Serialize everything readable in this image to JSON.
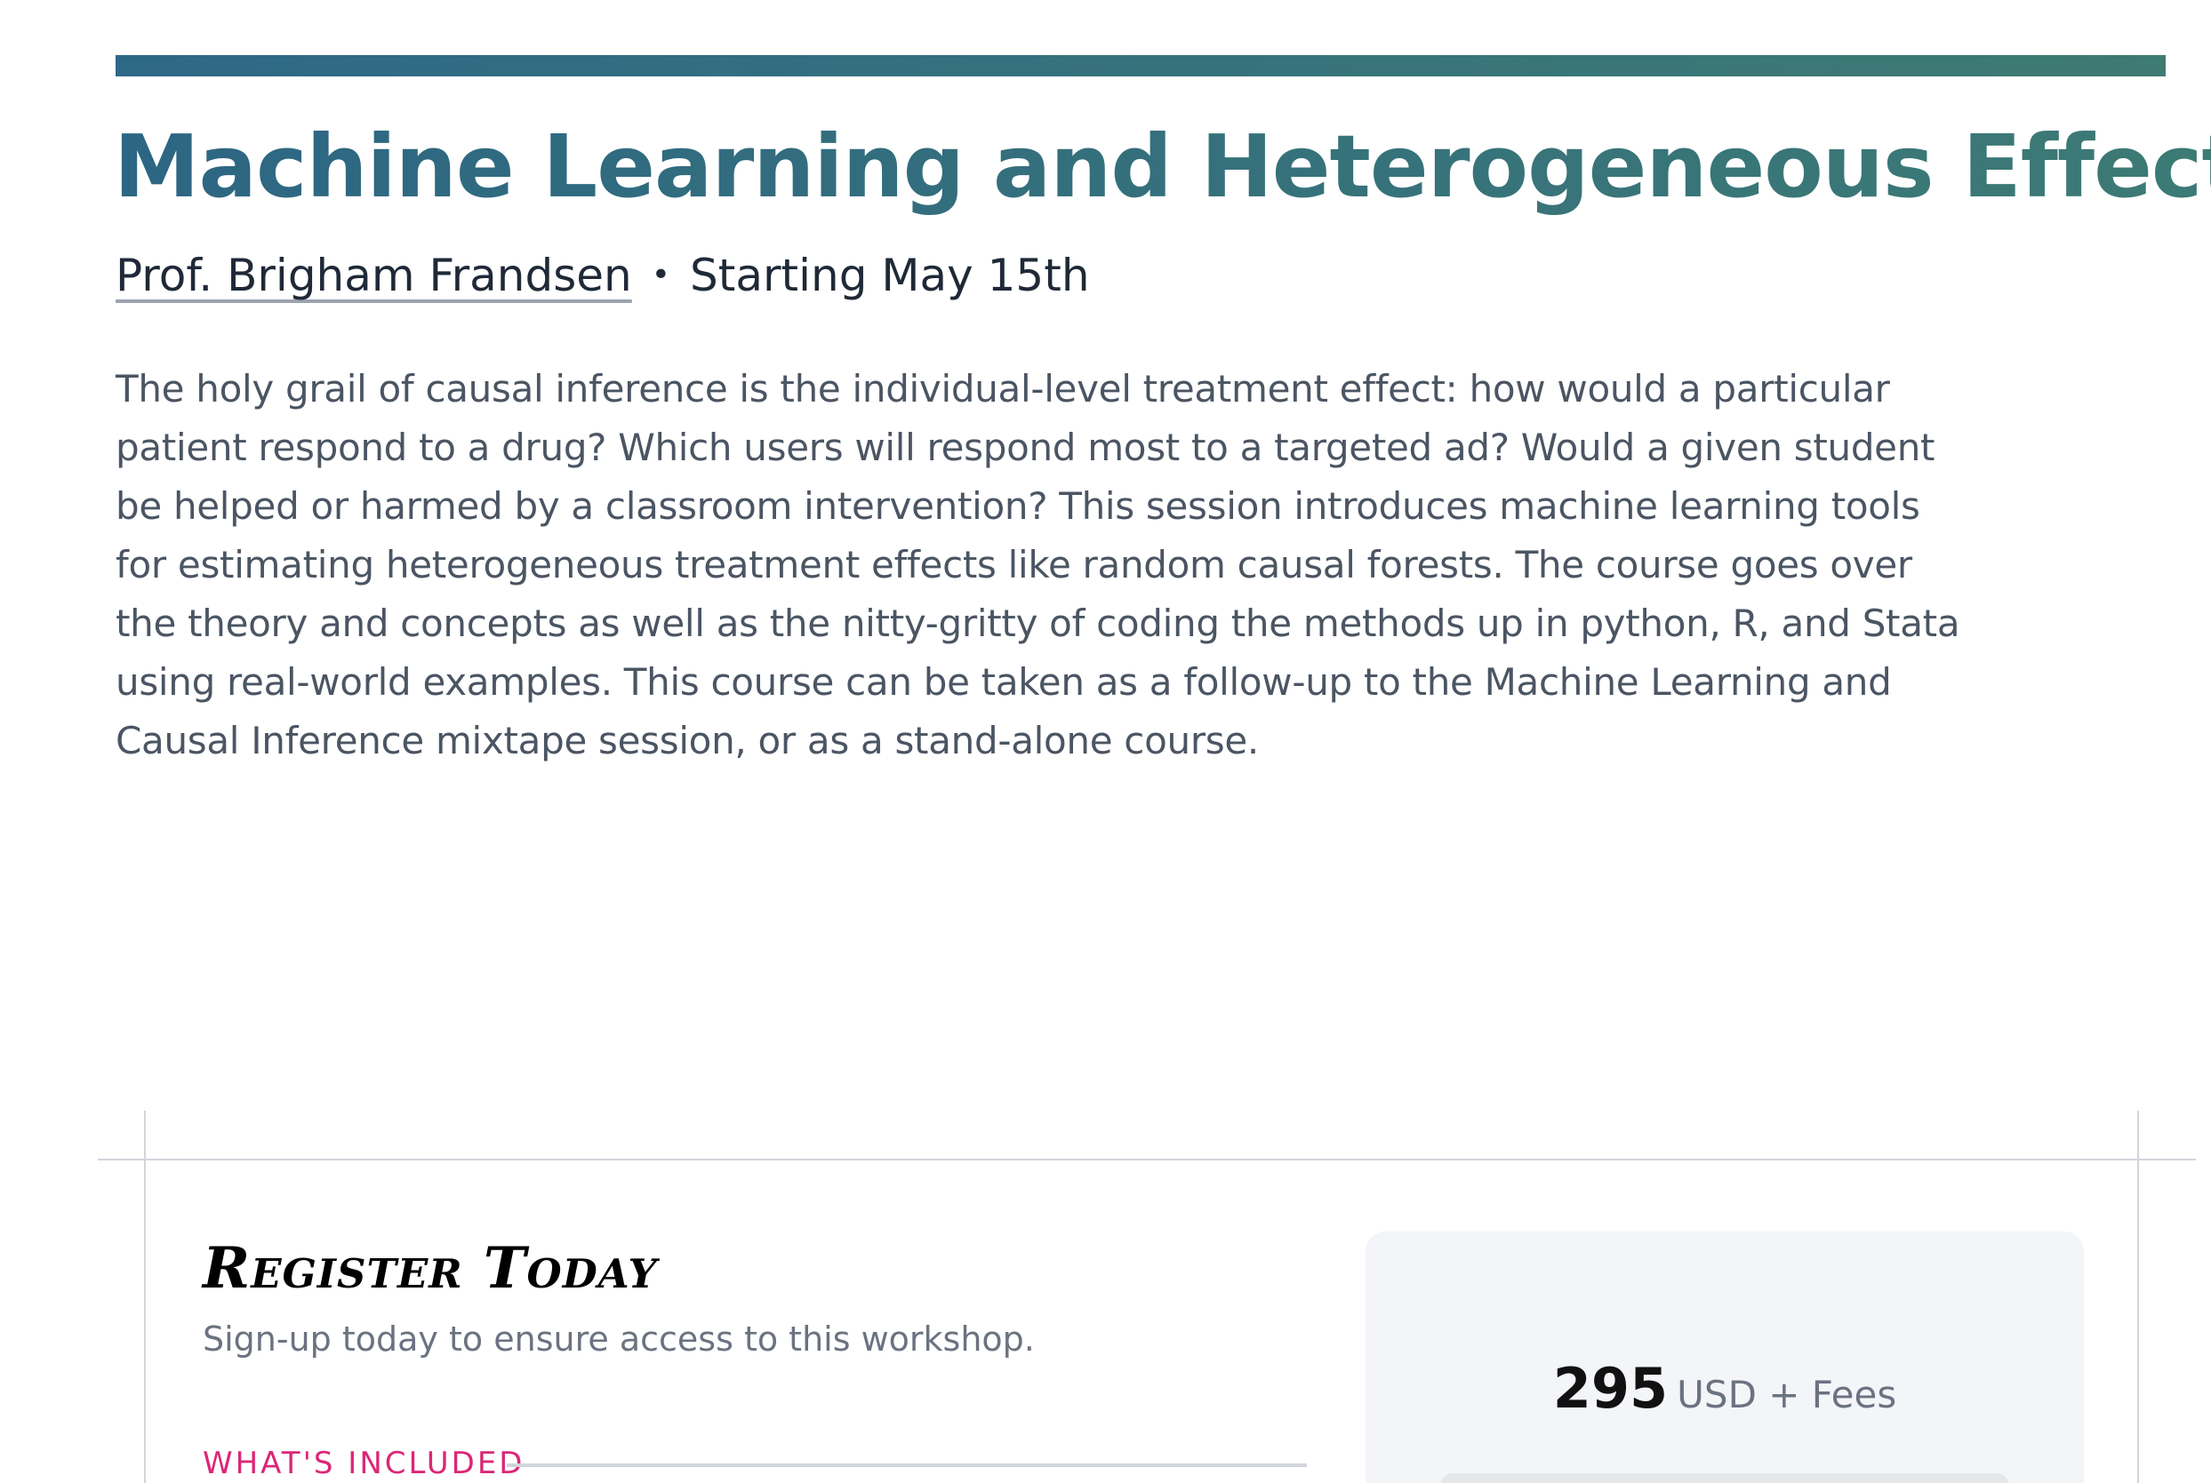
{
  "course": {
    "title": "Machine Learning and Heterogeneous Effects",
    "instructor": "Prof. Brigham Frandsen",
    "separator": "•",
    "start": "Starting May 15th",
    "description": "The holy grail of causal inference is the individual-level treatment effect: how would a particular patient respond to a drug? Which users will respond most to a targeted ad? Would a given student be helped or harmed by a classroom intervention? This session introduces machine learning tools for estimating heterogeneous treatment effects like random causal forests. The course goes over the theory and concepts as well as the nitty-gritty of coding the methods up in python, R, and Stata using real-world examples. This course can be taken as a follow-up to the Machine Learning and Causal Inference mixtape session, or as a stand-alone course."
  },
  "register": {
    "heading": "Register Today",
    "subheading": "Sign-up today to ensure access to this workshop.",
    "included_label": "WHAT'S INCLUDED",
    "price": {
      "amount": "295",
      "currency": "USD + Fees"
    }
  },
  "colors": {
    "accent_start": "#2e6887",
    "accent_end": "#3e7b72",
    "included_label": "#db2777",
    "price_panel_bg": "#f3f5f9"
  }
}
